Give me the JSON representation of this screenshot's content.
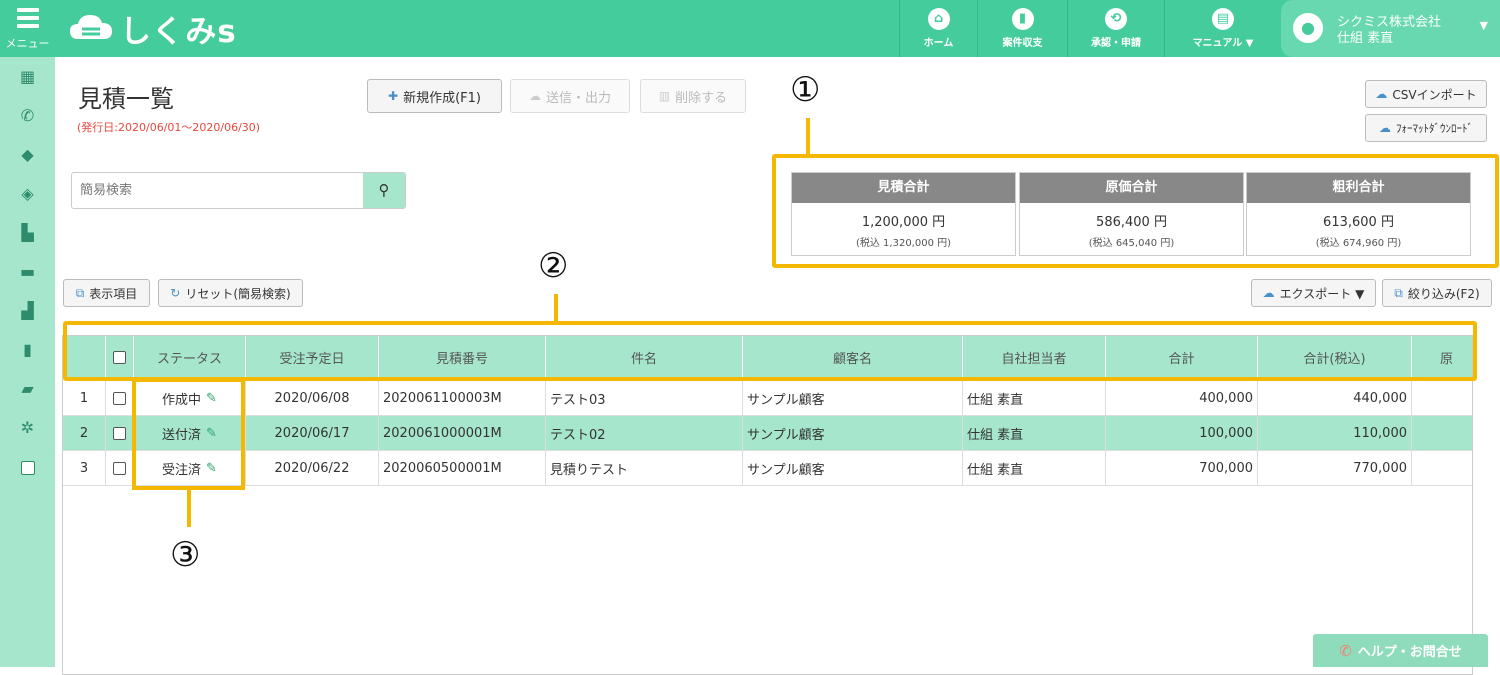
{
  "header": {
    "menu_label": "メニュー",
    "logo_text": "しくみs",
    "nav": [
      {
        "label": "ホーム",
        "icon": "home-icon"
      },
      {
        "label": "案件収支",
        "icon": "bar-chart-icon"
      },
      {
        "label": "承認・申請",
        "icon": "repeat-icon"
      },
      {
        "label": "マニュアル ▼",
        "icon": "book-icon"
      }
    ],
    "user": {
      "company": "シクミス株式会社",
      "name": "仕組 素直"
    }
  },
  "sidebar": {
    "icons": [
      "calendar-icon",
      "phone-icon",
      "tag-icon",
      "tags-icon",
      "bar-chart-icon",
      "card-icon",
      "signal-icon",
      "file-icon",
      "folder-open-icon",
      "gear-icon",
      "checkbox-icon"
    ]
  },
  "page": {
    "title": "見積一覧",
    "period": "(発行日:2020/06/01～2020/06/30)"
  },
  "toolbar": {
    "new_label": "新規作成(F1)",
    "send_label": "送信・出力",
    "delete_label": "削除する",
    "csv_import_label": "CSVインポート",
    "format_download_label": "ﾌｫｰﾏｯﾄﾀﾞｳﾝﾛｰﾄﾞ",
    "columns_label": "表示項目",
    "reset_label": "リセット(簡易検索)",
    "export_label": "エクスポート ▼",
    "filter_label": "絞り込み(F2)"
  },
  "search": {
    "placeholder": "簡易検索",
    "value": ""
  },
  "summary": [
    {
      "title": "見積合計",
      "value": "1,200,000 円",
      "tax": "(税込 1,320,000 円)"
    },
    {
      "title": "原価合計",
      "value": "586,400 円",
      "tax": "(税込 645,040 円)"
    },
    {
      "title": "粗利合計",
      "value": "613,600 円",
      "tax": "(税込 674,960 円)"
    }
  ],
  "table": {
    "headers": [
      "ステータス",
      "受注予定日",
      "見積番号",
      "件名",
      "顧客名",
      "自社担当者",
      "合計",
      "合計(税込)",
      "原"
    ],
    "rows": [
      {
        "no": "1",
        "status": "作成中",
        "date": "2020/06/08",
        "number": "2020061100003M",
        "subject": "テスト03",
        "customer": "サンプル顧客",
        "staff": "仕組 素直",
        "total": "400,000",
        "total_tax": "440,000"
      },
      {
        "no": "2",
        "status": "送付済",
        "date": "2020/06/17",
        "number": "2020061000001M",
        "subject": "テスト02",
        "customer": "サンプル顧客",
        "staff": "仕組 素直",
        "total": "100,000",
        "total_tax": "110,000"
      },
      {
        "no": "3",
        "status": "受注済",
        "date": "2020/06/22",
        "number": "2020060500001M",
        "subject": "見積りテスト",
        "customer": "サンプル顧客",
        "staff": "仕組 素直",
        "total": "700,000",
        "total_tax": "770,000"
      }
    ]
  },
  "callouts": [
    "①",
    "②",
    "③"
  ],
  "help_label": "ヘルプ・お問合せ",
  "colors": {
    "accent": "#45cc9c",
    "light_accent": "#a5e6cd",
    "highlight": "#f5b800",
    "period_text": "#e8493e"
  }
}
